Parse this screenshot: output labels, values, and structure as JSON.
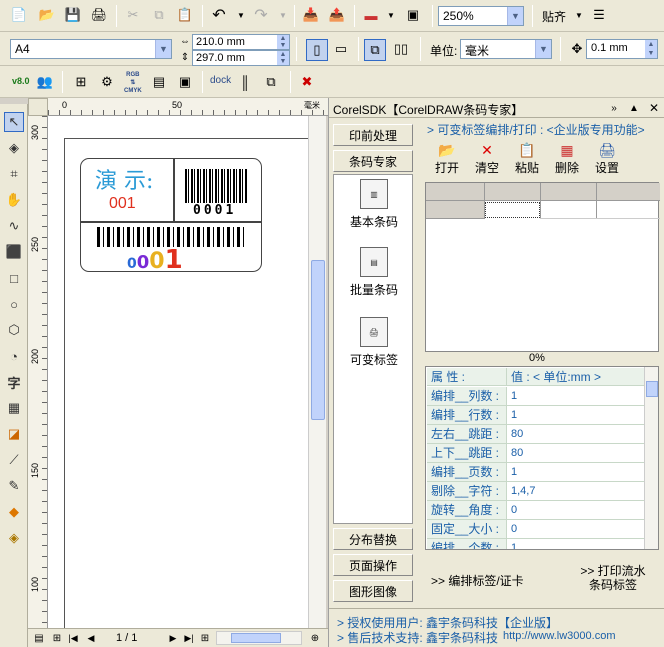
{
  "toolbar1": {
    "zoom": "250%",
    "snap_label": "贴齐"
  },
  "toolbar2": {
    "paper_size": "A4",
    "width": "210.0 mm",
    "height": "297.0 mm",
    "units_label": "单位:",
    "units_value": "毫米",
    "nudge": "0.1 mm"
  },
  "toolbar3": {
    "version": "v8.0",
    "rgb_label": "RGB",
    "cmyk_label": "CMYK",
    "dock_label": "dock"
  },
  "ruler": {
    "top_ticks": [
      "0",
      "50"
    ],
    "left_ticks": [
      "300",
      "250",
      "200",
      "150",
      "100"
    ],
    "corner_unit": "毫米"
  },
  "label": {
    "demo_text": "演 示:",
    "number_red": "001",
    "barcode_number": "0001",
    "big_number": [
      "0",
      "0",
      "0",
      "1"
    ]
  },
  "pager": {
    "page_text": "1 / 1"
  },
  "docker": {
    "title": "CorelSDK【CorelDRAW条码专家】",
    "nav_top": [
      "印前处理",
      "条码专家"
    ],
    "big_icons": [
      {
        "label": "基本条码"
      },
      {
        "label": "批量条码"
      },
      {
        "label": "可变标签"
      }
    ],
    "nav_bottom": [
      "分布替换",
      "页面操作",
      "图形图像"
    ],
    "header": "> 可变标签编排/打印 : <企业版专用功能>",
    "actions": [
      "打开",
      "清空",
      "粘贴",
      "删除",
      "设置"
    ],
    "progress": "0%",
    "props_key_header": "属 性 :",
    "props_val_header": "值 : < 单位:mm >",
    "props": [
      {
        "k": "编排__列数 :",
        "v": "1"
      },
      {
        "k": "编排__行数 :",
        "v": "1"
      },
      {
        "k": "左右__跳距 :",
        "v": "80"
      },
      {
        "k": "上下__跳距 :",
        "v": "80"
      },
      {
        "k": "编排__页数 :",
        "v": "1"
      },
      {
        "k": "剔除__字符 :",
        "v": "1,4,7"
      },
      {
        "k": "旋转__角度 :",
        "v": "0"
      },
      {
        "k": "固定__大小 :",
        "v": "0"
      },
      {
        "k": "编排__个数 :",
        "v": "1"
      }
    ],
    "arrange_btn": ">>  编排标签/证卡",
    "print_btn_line1": ">>  打印流水",
    "print_btn_line2": "条码标签",
    "footer_user": "> 授权使用用户: 鑫宇条码科技【企业版】",
    "footer_support": "> 售后技术支持: 鑫宇条码科技",
    "footer_url": "http://www.lw3000.com"
  }
}
